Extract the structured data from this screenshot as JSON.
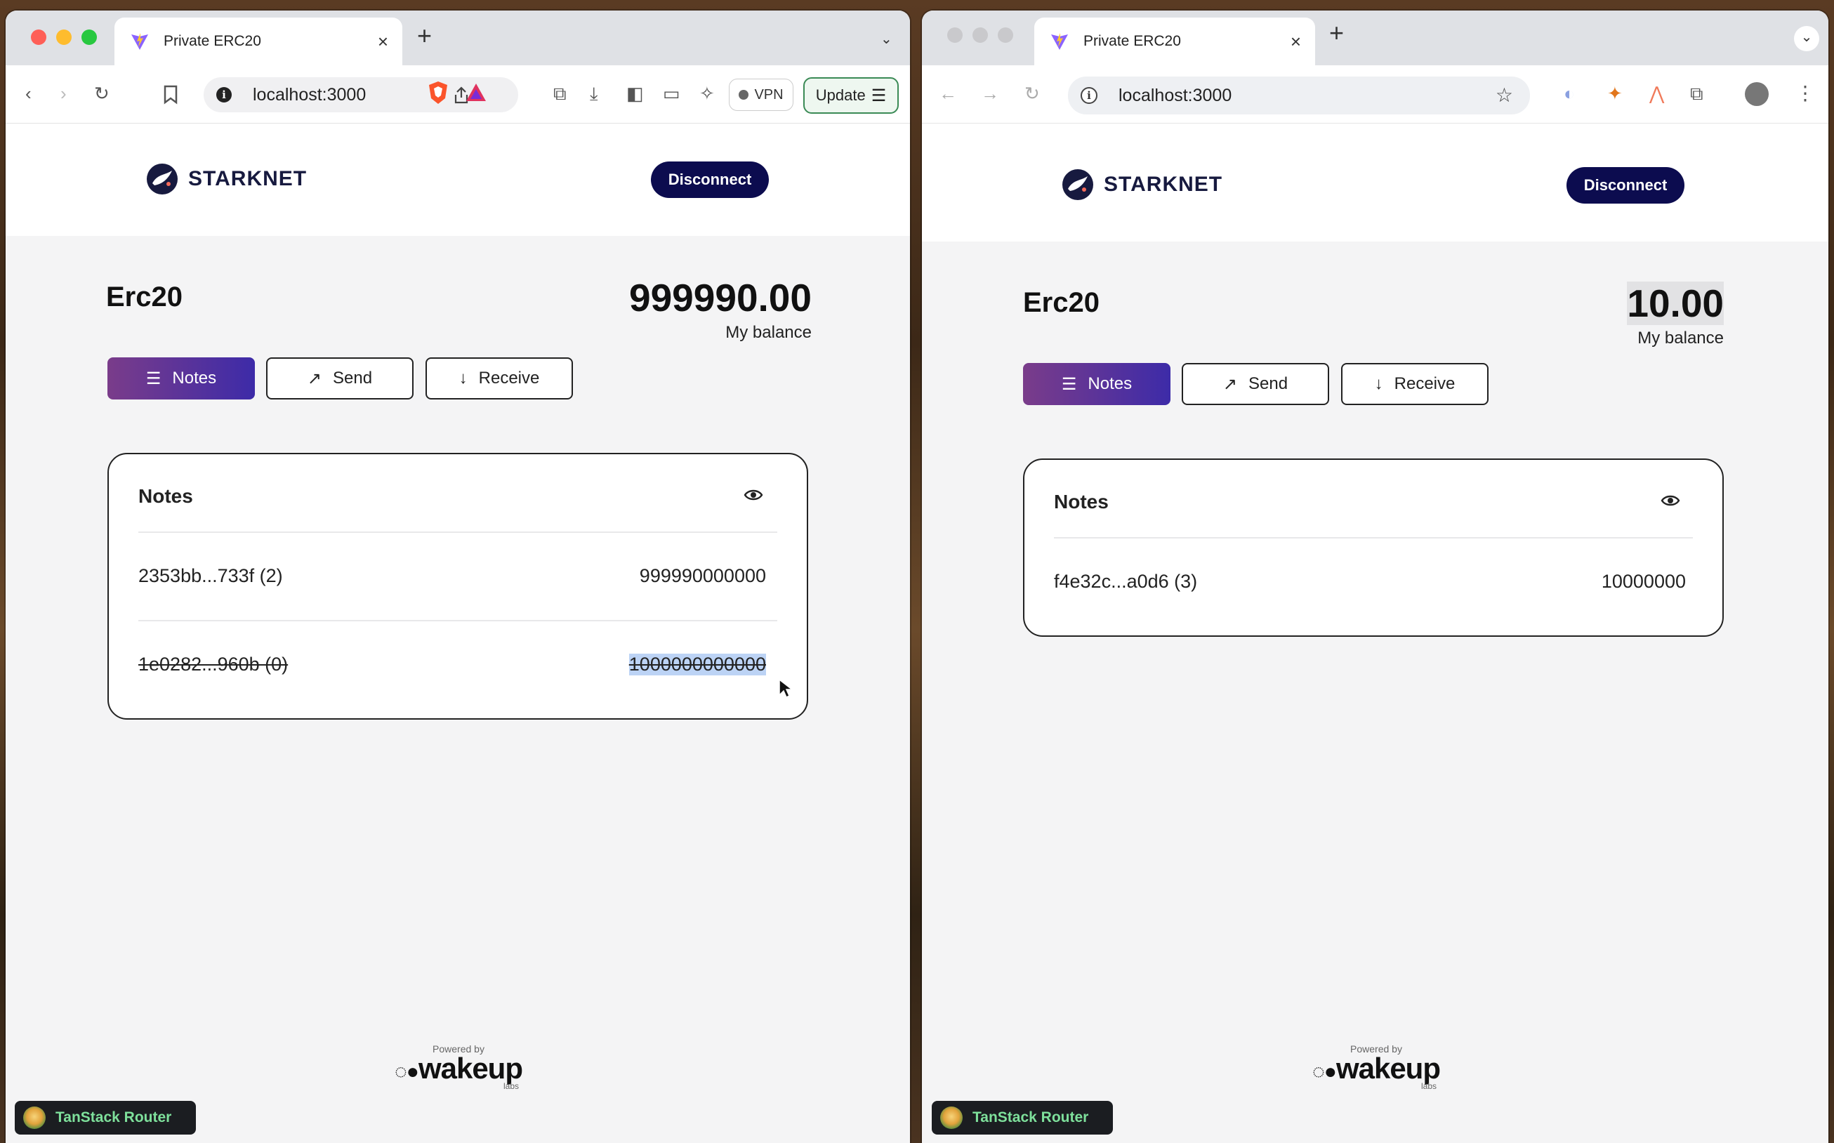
{
  "browser_left": {
    "tab_title": "Private ERC20",
    "tab_close": "×",
    "new_tab": "+",
    "url": "localhost:3000",
    "vpn_label": "VPN",
    "update_label": "Update"
  },
  "browser_right": {
    "tab_title": "Private ERC20",
    "tab_close": "×",
    "new_tab": "+",
    "url": "localhost:3000"
  },
  "app_left": {
    "brand": "STARKNET",
    "disconnect_label": "Disconnect",
    "token_name": "Erc20",
    "balance": "999990.00",
    "balance_label": "My balance",
    "actions": {
      "notes": "Notes",
      "send": "Send",
      "receive": "Receive"
    },
    "notes_title": "Notes",
    "notes": [
      {
        "id": "2353bb...733f (2)",
        "value": "999990000000",
        "spent": false
      },
      {
        "id": "1e0282...960b (0)",
        "value": "1000000000000",
        "spent": true
      }
    ],
    "powered_by": "Powered by",
    "powered_logo": "wakeup",
    "powered_labs": "labs",
    "devtools_label": "TanStack Router"
  },
  "app_right": {
    "brand": "STARKNET",
    "disconnect_label": "Disconnect",
    "token_name": "Erc20",
    "balance": "10.00",
    "balance_label": "My balance",
    "actions": {
      "notes": "Notes",
      "send": "Send",
      "receive": "Receive"
    },
    "notes_title": "Notes",
    "notes": [
      {
        "id": "f4e32c...a0d6 (3)",
        "value": "10000000",
        "spent": false
      }
    ],
    "powered_by": "Powered by",
    "powered_logo": "wakeup",
    "powered_labs": "labs",
    "devtools_label": "TanStack Router"
  },
  "colors": {
    "disconnect_bg": "#0c0c4f",
    "primary_gradient_start": "#7a3c8a",
    "primary_gradient_end": "#3d2ba8",
    "devtools_text": "#7ee09b",
    "selection": "#bcd3f5"
  }
}
